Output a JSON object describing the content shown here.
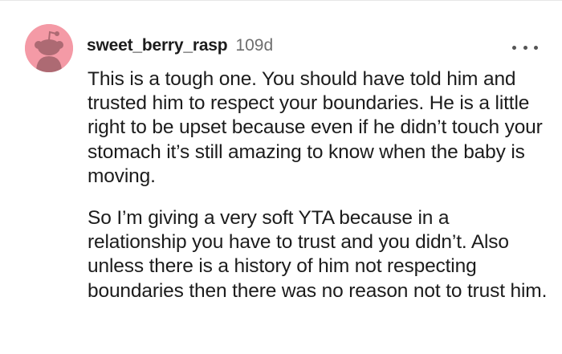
{
  "comment": {
    "author": "sweet_berry_rasp",
    "age": "109d",
    "avatar_icon": "snoo-avatar-icon",
    "avatar_color": "#f49aa6",
    "paragraphs": [
      "This is a tough one. You should have told him and trusted him to respect your boundaries. He is a little right to be upset because even if he didn’t touch your stomach it’s still amazing to know when the baby is moving.",
      "So I’m giving a very soft YTA because in a relationship you have to trust and you didn’t. Also unless there is a history of him not respecting boundaries then there was no reason not to trust him."
    ],
    "more_icon": "more-options-icon"
  }
}
